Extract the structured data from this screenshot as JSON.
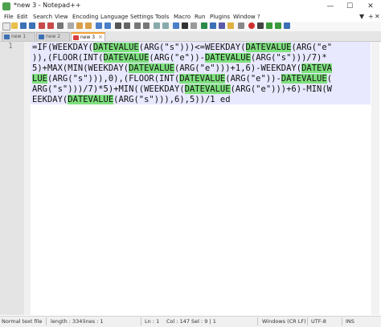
{
  "window": {
    "title": "*new 3 - Notepad++"
  },
  "menu": [
    "File",
    "Edit",
    "Search",
    "View",
    "Encoding",
    "Language",
    "Settings",
    "Tools",
    "Macro",
    "Run",
    "Plugins",
    "Window",
    "?"
  ],
  "tabs": [
    {
      "label": "new 1",
      "active": false
    },
    {
      "label": "new 2",
      "active": false
    },
    {
      "label": "new 3",
      "active": true
    }
  ],
  "editor": {
    "line_numbers": [
      "1"
    ],
    "lines": [
      [
        {
          "t": "=IF(WEEKDAY("
        },
        {
          "t": "DATEVALUE",
          "h": true
        },
        {
          "t": "(ARG(\"s\")))<=WEEKDAY("
        },
        {
          "t": "DATEVALUE",
          "h": true
        },
        {
          "t": "(ARG(\"e\""
        }
      ],
      [
        {
          "t": ")),(FLOOR(INT("
        },
        {
          "t": "DATEVALUE",
          "h": true
        },
        {
          "t": "(ARG(\"e\"))-"
        },
        {
          "t": "DATEVALUE",
          "h": true
        },
        {
          "t": "(ARG(\"s\")))/7)*"
        }
      ],
      [
        {
          "t": "5)+MAX(MIN(WEEKDAY("
        },
        {
          "t": "DATEVALUE",
          "h": true
        },
        {
          "t": "(ARG(\"e\")))+1,6)-WEEKDAY("
        },
        {
          "t": "DATEVA",
          "h": true
        }
      ],
      [
        {
          "t": "LUE",
          "h": true
        },
        {
          "t": "(ARG(\"s\"))),0),(FLOOR(INT("
        },
        {
          "t": "DATEVALUE",
          "h": true
        },
        {
          "t": "(ARG(\"e\"))-"
        },
        {
          "t": "DATEVALUE",
          "h": true
        },
        {
          "t": "("
        }
      ],
      [
        {
          "t": "ARG(\"s\")))/7)*5)+MIN((WEEKDAY("
        },
        {
          "t": "DATEVALUE",
          "h": true
        },
        {
          "t": "(ARG(\"e\")))+6)-MIN(W"
        }
      ],
      [
        {
          "t": "EEKDAY("
        },
        {
          "t": "DATEVALUE",
          "h": true
        },
        {
          "t": "(ARG(\"s\"))),6),5))/1 ed"
        }
      ]
    ]
  },
  "status": {
    "doc_type": "Normal text file",
    "length": "length : 334",
    "lines": "lines : 1",
    "ln": "Ln : 1",
    "col": "Col : 147",
    "sel": "Sel : 9 | 1",
    "eol": "Windows (CR LF)",
    "encoding": "UTF-8",
    "mode": "INS"
  },
  "colors": {
    "highlight": "#7fe07f",
    "active_tab_accent": "#f3a03a",
    "current_line": "#e8e8ff"
  },
  "icons": [
    "new-file-icon",
    "open-icon",
    "save-icon",
    "save-all-icon",
    "close-icon",
    "close-all-icon",
    "print-icon",
    "cut-icon",
    "copy-icon",
    "paste-icon",
    "undo-icon",
    "redo-icon",
    "find-icon",
    "replace-icon",
    "zoom-in-icon",
    "zoom-out-icon",
    "sync-v-icon",
    "sync-h-icon",
    "word-wrap-icon",
    "show-all-chars-icon",
    "indent-guide-icon",
    "udl-icon",
    "doc-map-icon",
    "function-list-icon",
    "folder-workspace-icon",
    "monitoring-icon",
    "record-macro-icon",
    "stop-macro-icon",
    "play-macro-icon",
    "run-macro-icon",
    "save-macro-icon"
  ]
}
